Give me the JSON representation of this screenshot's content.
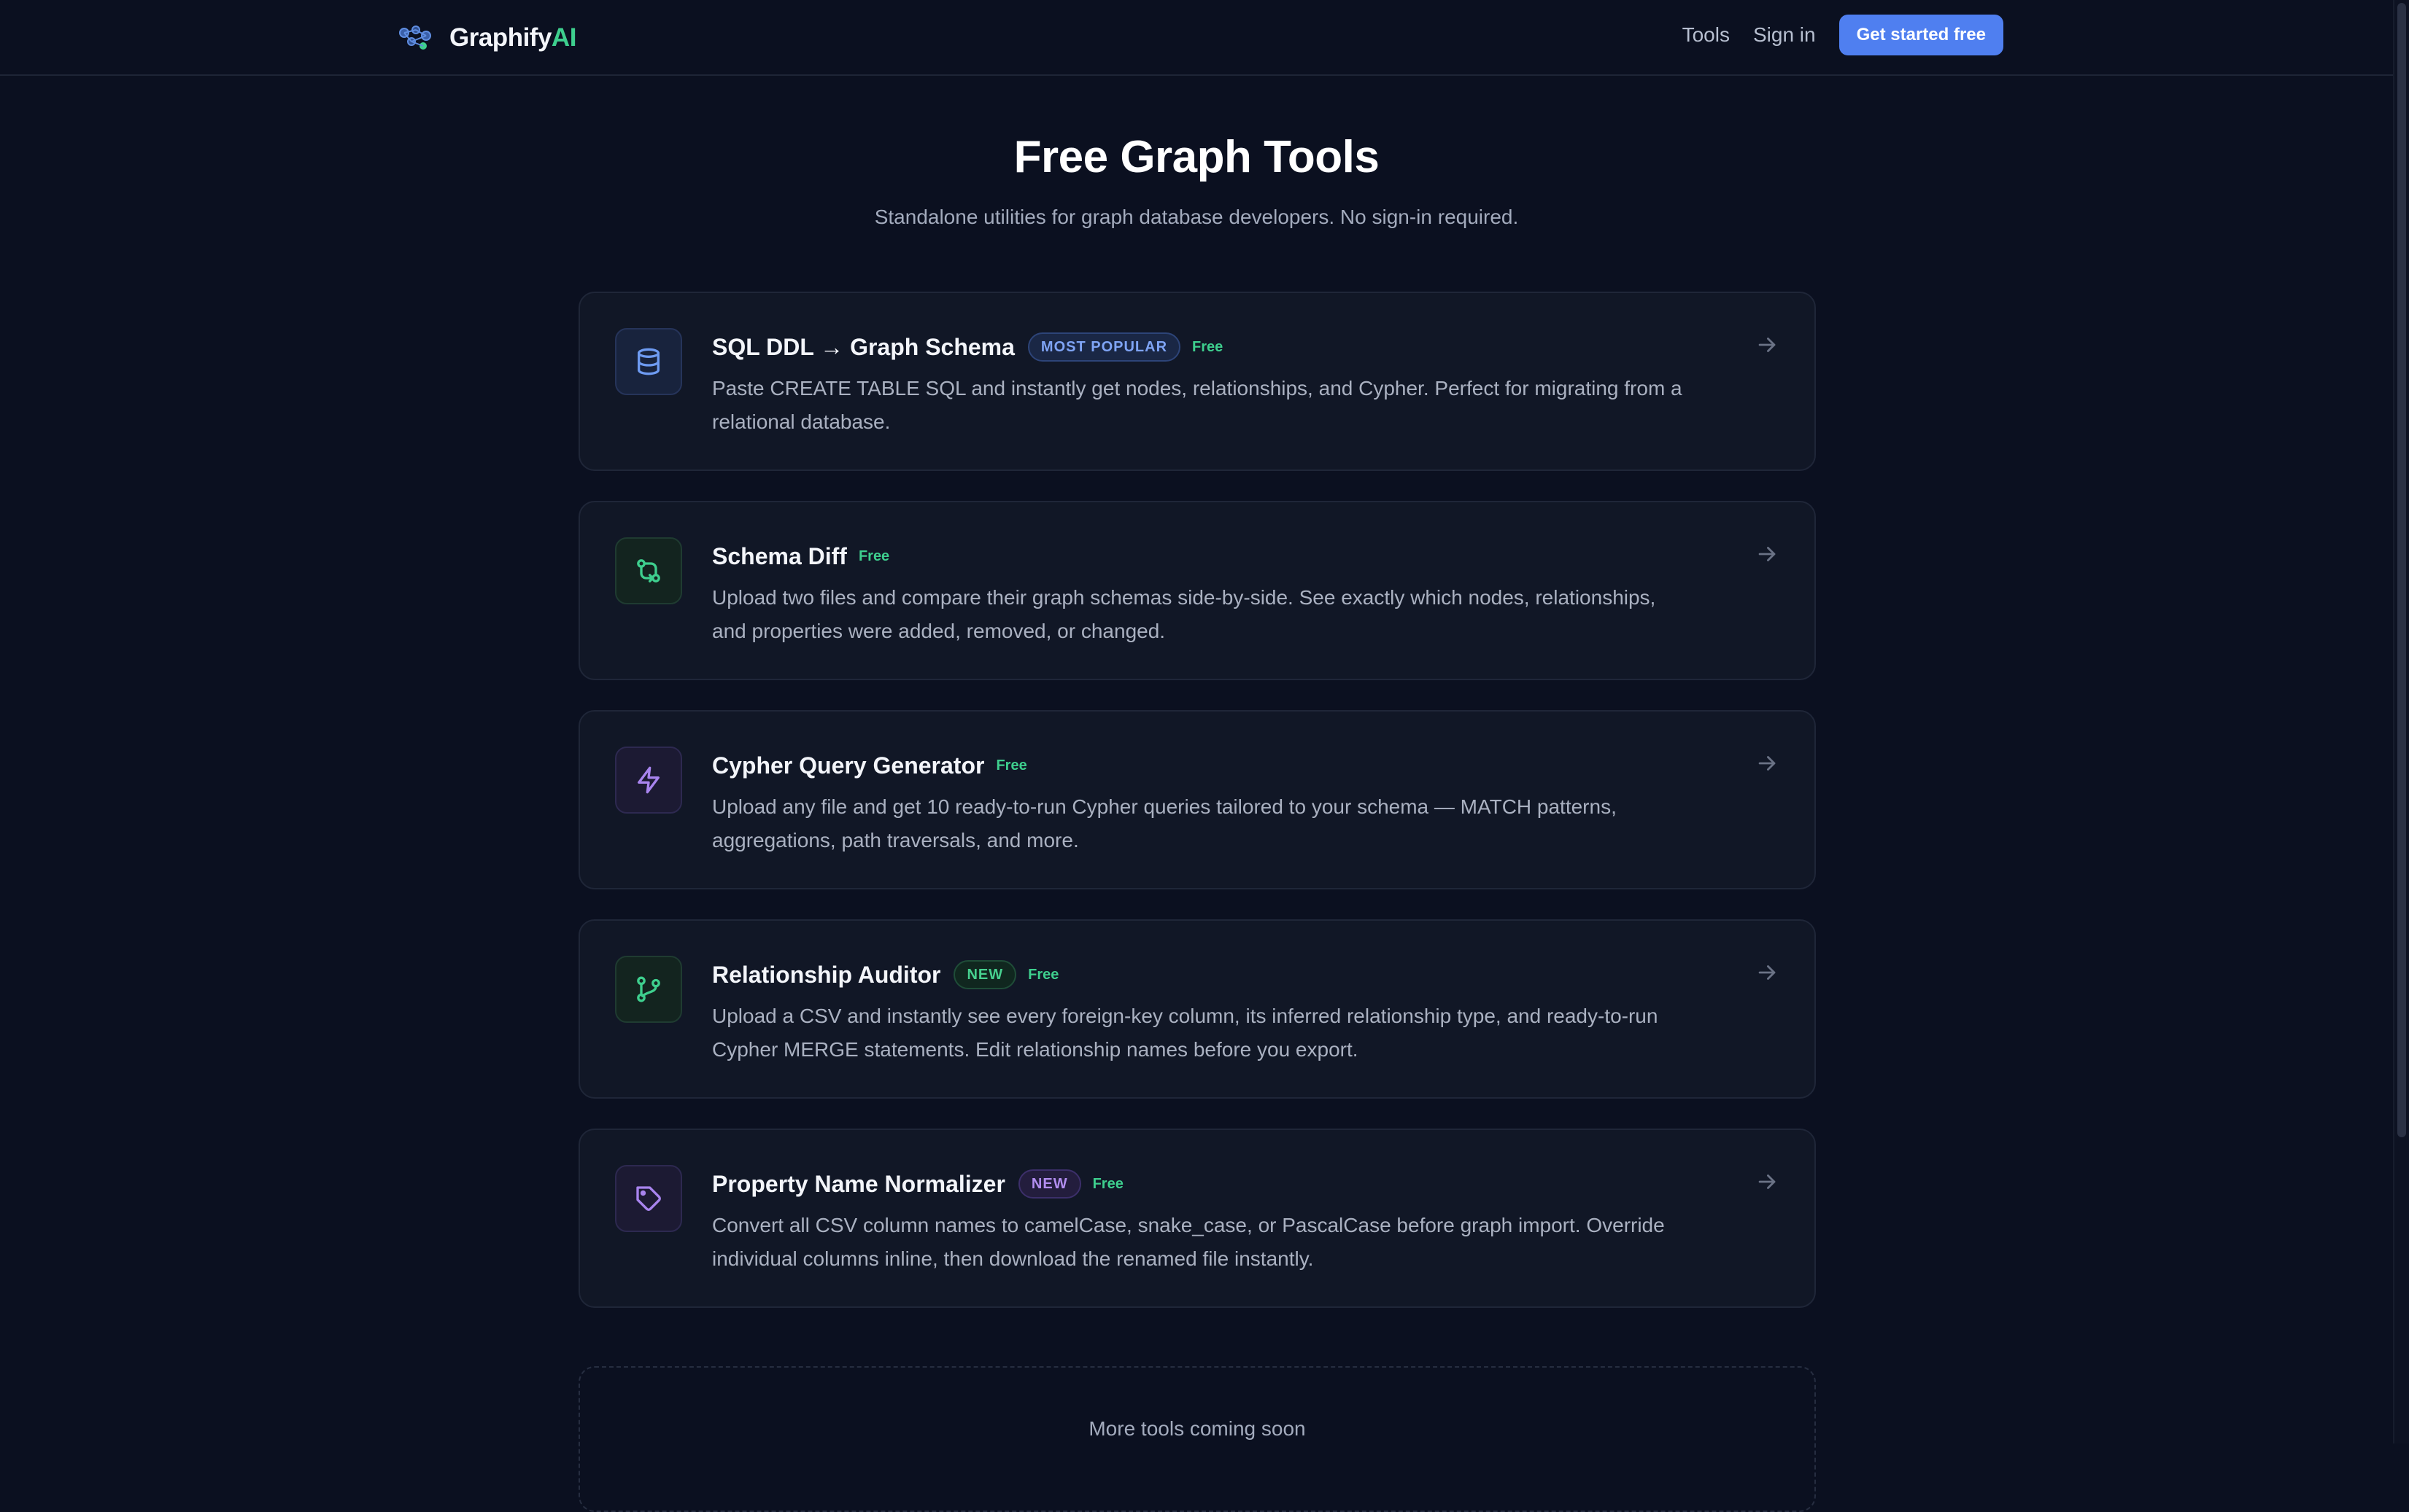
{
  "nav": {
    "brand_name": "Graphify",
    "brand_accent": "AI",
    "links": [
      "Tools",
      "Sign in"
    ],
    "cta_label": "Get started free"
  },
  "hero": {
    "title": "Free Graph Tools",
    "subtitle": "Standalone utilities for graph database developers. No sign-in required."
  },
  "tools": [
    {
      "title": "SQL DDL → Graph Schema",
      "badge": "MOST POPULAR",
      "free_label": "Free",
      "description": "Paste CREATE TABLE SQL and instantly get nodes, relationships, and Cypher. Perfect for migrating from a relational database.",
      "icon": "database-icon"
    },
    {
      "title": "Schema Diff",
      "badge": "",
      "free_label": "Free",
      "description": "Upload two files and compare their graph schemas side-by-side. See exactly which nodes, relationships, and properties were added, removed, or changed.",
      "icon": "git-compare-icon"
    },
    {
      "title": "Cypher Query Generator",
      "badge": "",
      "free_label": "Free",
      "description": "Upload any file and get 10 ready-to-run Cypher queries tailored to your schema — MATCH patterns, aggregations, path traversals, and more.",
      "icon": "lightning-icon"
    },
    {
      "title": "Relationship Auditor",
      "badge": "NEW",
      "free_label": "Free",
      "description": "Upload a CSV and instantly see every foreign-key column, its inferred relationship type, and ready-to-run Cypher MERGE statements. Edit relationship names before you export.",
      "icon": "git-branch-icon"
    },
    {
      "title": "Property Name Normalizer",
      "badge": "NEW",
      "free_label": "Free",
      "description": "Convert all CSV column names to camelCase, snake_case, or PascalCase before graph import. Override individual columns inline, then download the renamed file instantly.",
      "icon": "tag-icon"
    }
  ],
  "coming_soon": "More tools coming soon",
  "colors": {
    "background": "#0b1020",
    "card": "#111726",
    "accent_green": "#3ecf8e",
    "accent_blue": "#4f7ff0",
    "accent_purple": "#b28ef0"
  }
}
